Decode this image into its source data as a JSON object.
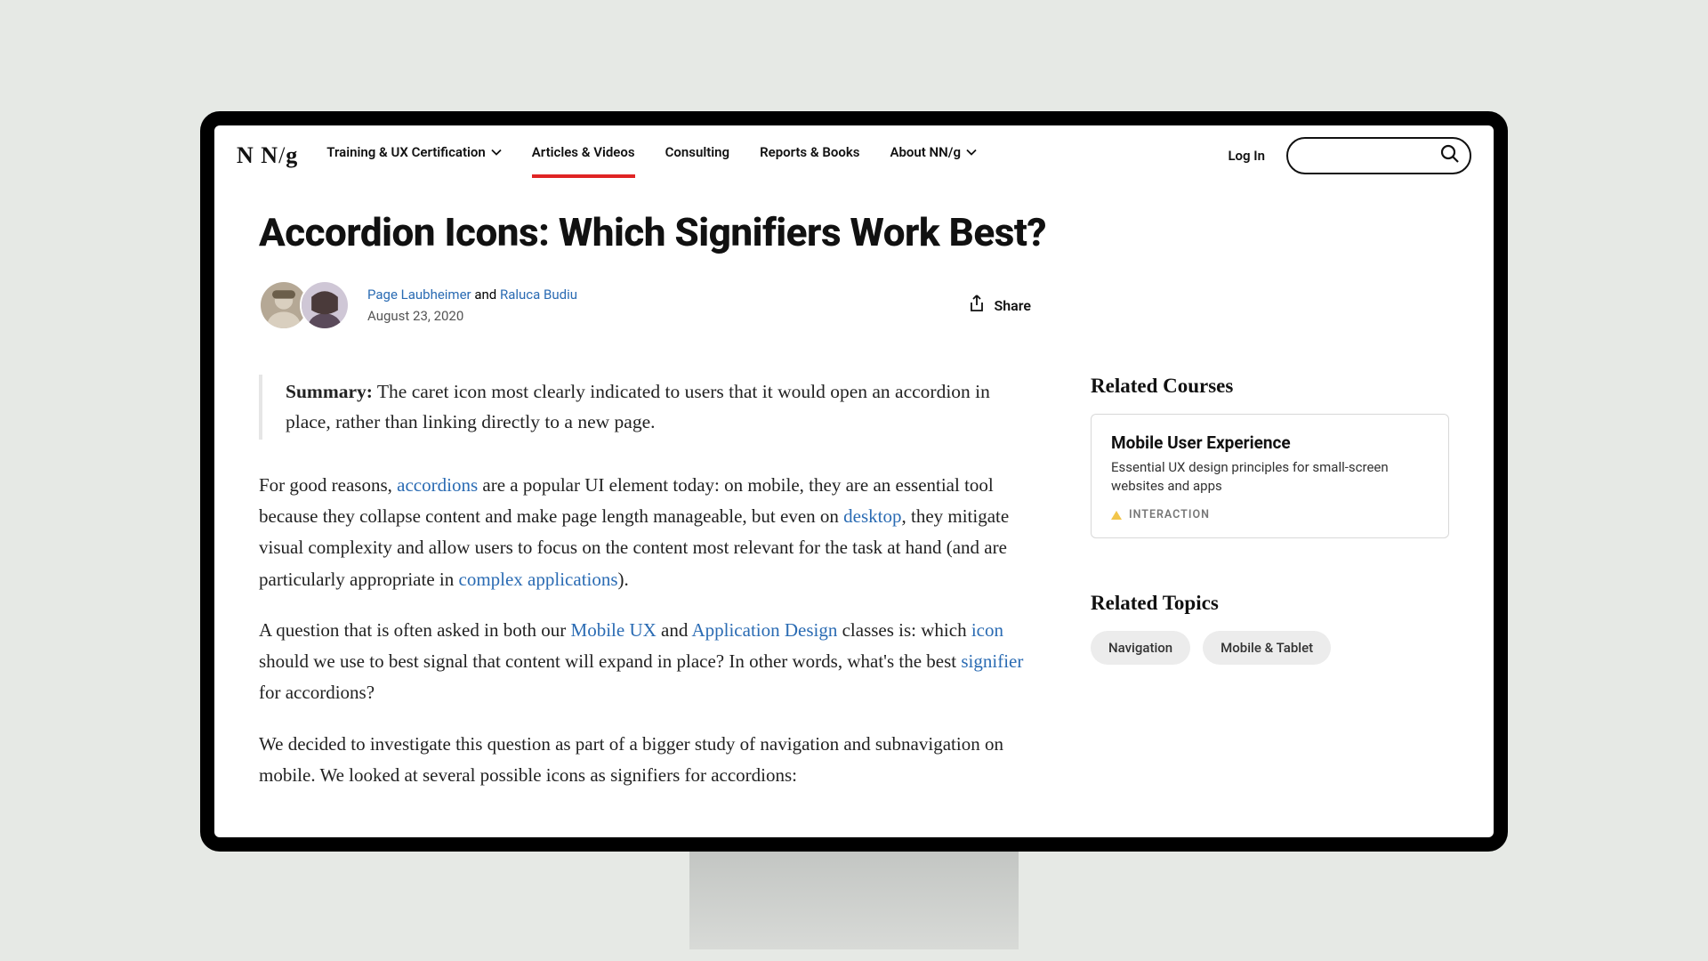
{
  "logo_text": "N N /g",
  "nav": {
    "training": "Training & UX Certification",
    "articles": "Articles & Videos",
    "consulting": "Consulting",
    "reports": "Reports & Books",
    "about": "About NN/g"
  },
  "login": "Log In",
  "article": {
    "title": "Accordion Icons: Which Signifiers Work Best?",
    "author1": "Page Laubheimer",
    "and": " and ",
    "author2": "Raluca Budiu",
    "date": "August 23, 2020",
    "share": "Share",
    "summary_label": "Summary:",
    "summary_text": "  The caret icon most clearly indicated to users that it would open an accordion in place, rather than linking directly to a new page.",
    "p1a": "For good reasons, ",
    "p1_link1": "accordions",
    "p1b": " are a popular UI element today: on mobile, they are an essential tool because they collapse content and make page length manageable, but even on ",
    "p1_link2": "desktop",
    "p1c": ", they mitigate visual complexity and allow users to focus on the content most relevant for the task at hand (and are particularly appropriate in ",
    "p1_link3": "complex applications",
    "p1d": ").",
    "p2a": "A question that is often asked in both our ",
    "p2_link1": "Mobile UX",
    "p2b": " and ",
    "p2_link2": "Application Design",
    "p2c": " classes is: which ",
    "p2_link3": "icon",
    "p2d": " should we use to best signal that content will expand in place? In other words, what's the best ",
    "p2_link4": "signifier",
    "p2e": " for accordions?",
    "p3": "We decided to investigate this question as part of a bigger study of navigation and subnavigation on mobile. We looked at several possible icons as signifiers for accordions:"
  },
  "sidebar": {
    "courses_heading": "Related Courses",
    "course": {
      "title": "Mobile User Experience",
      "desc": "Essential UX design principles for small-screen websites and apps",
      "tag": "INTERACTION"
    },
    "topics_heading": "Related Topics",
    "chip1": "Navigation",
    "chip2": "Mobile & Tablet"
  }
}
